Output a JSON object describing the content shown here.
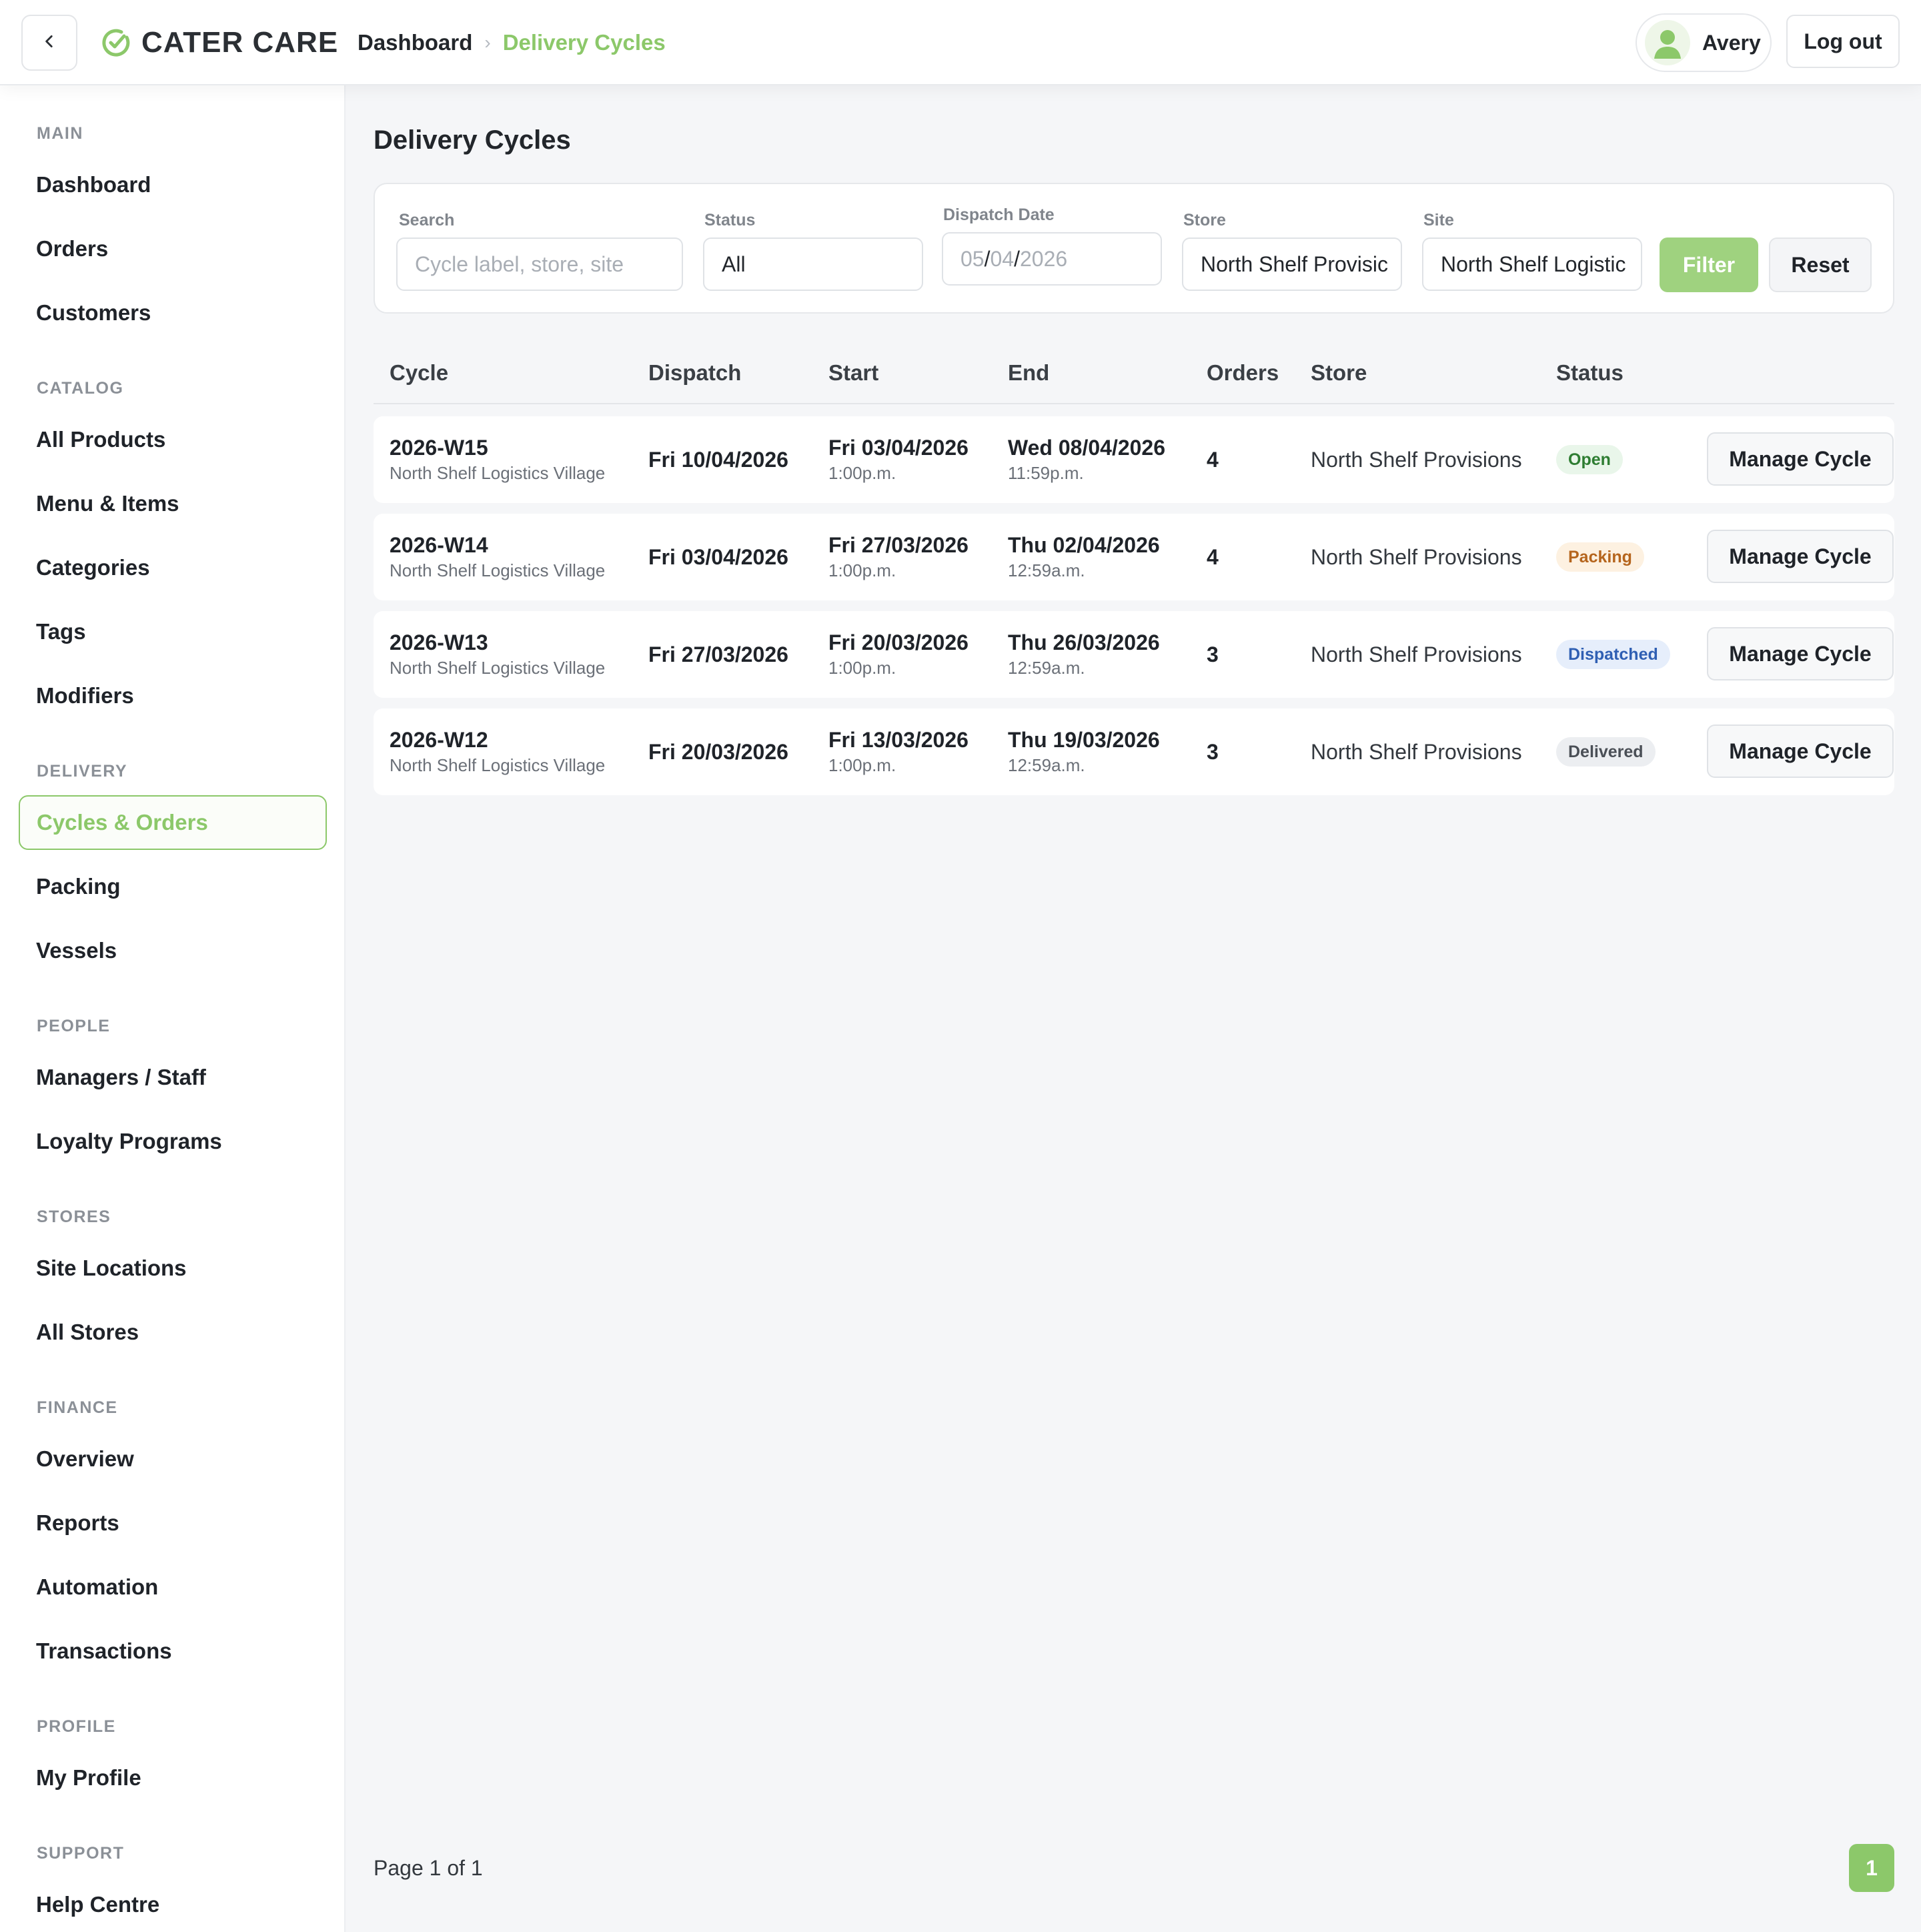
{
  "header": {
    "brand": "CATER CARE",
    "breadcrumb_home": "Dashboard",
    "breadcrumb_separator": "›",
    "breadcrumb_current": "Delivery Cycles",
    "user_name": "Avery",
    "logout_label": "Log out"
  },
  "sidebar": {
    "sections": [
      {
        "title": "MAIN",
        "items": [
          "Dashboard",
          "Orders",
          "Customers"
        ]
      },
      {
        "title": "CATALOG",
        "items": [
          "All Products",
          "Menu & Items",
          "Categories",
          "Tags",
          "Modifiers"
        ]
      },
      {
        "title": "DELIVERY",
        "items": [
          "Cycles & Orders",
          "Packing",
          "Vessels"
        ]
      },
      {
        "title": "PEOPLE",
        "items": [
          "Managers / Staff",
          "Loyalty Programs"
        ]
      },
      {
        "title": "STORES",
        "items": [
          "Site Locations",
          "All Stores"
        ]
      },
      {
        "title": "FINANCE",
        "items": [
          "Overview",
          "Reports",
          "Automation",
          "Transactions"
        ]
      },
      {
        "title": "PROFILE",
        "items": [
          "My Profile"
        ]
      },
      {
        "title": "SUPPORT",
        "items": [
          "Help Centre"
        ]
      }
    ],
    "active_item": "Cycles & Orders"
  },
  "page": {
    "title": "Delivery Cycles"
  },
  "filters": {
    "search_label": "Search",
    "search_placeholder": "Cycle label, store, site",
    "status_label": "Status",
    "status_value": "All",
    "dispatch_label": "Dispatch Date",
    "dispatch_day": "05",
    "dispatch_month": "04",
    "dispatch_year": "2026",
    "date_separator": "/",
    "store_label": "Store",
    "store_value": "North Shelf Provisic",
    "site_label": "Site",
    "site_value": "North Shelf Logistic",
    "filter_button": "Filter",
    "reset_button": "Reset"
  },
  "table": {
    "columns": [
      "Cycle",
      "Dispatch",
      "Start",
      "End",
      "Orders",
      "Store",
      "Status"
    ],
    "action_label": "Manage Cycle",
    "rows": [
      {
        "cycle": "2026-W15",
        "site": "North Shelf Logistics Village",
        "dispatch": "Fri 10/04/2026",
        "start_date": "Fri 03/04/2026",
        "start_time": "1:00p.m.",
        "end_date": "Wed 08/04/2026",
        "end_time": "11:59p.m.",
        "orders": "4",
        "store": "North Shelf Provisions",
        "status": "Open",
        "status_kind": "open"
      },
      {
        "cycle": "2026-W14",
        "site": "North Shelf Logistics Village",
        "dispatch": "Fri 03/04/2026",
        "start_date": "Fri 27/03/2026",
        "start_time": "1:00p.m.",
        "end_date": "Thu 02/04/2026",
        "end_time": "12:59a.m.",
        "orders": "4",
        "store": "North Shelf Provisions",
        "status": "Packing",
        "status_kind": "packing"
      },
      {
        "cycle": "2026-W13",
        "site": "North Shelf Logistics Village",
        "dispatch": "Fri 27/03/2026",
        "start_date": "Fri 20/03/2026",
        "start_time": "1:00p.m.",
        "end_date": "Thu 26/03/2026",
        "end_time": "12:59a.m.",
        "orders": "3",
        "store": "North Shelf Provisions",
        "status": "Dispatched",
        "status_kind": "dispatched"
      },
      {
        "cycle": "2026-W12",
        "site": "North Shelf Logistics Village",
        "dispatch": "Fri 20/03/2026",
        "start_date": "Fri 13/03/2026",
        "start_time": "1:00p.m.",
        "end_date": "Thu 19/03/2026",
        "end_time": "12:59a.m.",
        "orders": "3",
        "store": "North Shelf Provisions",
        "status": "Delivered",
        "status_kind": "delivered"
      }
    ]
  },
  "pagination": {
    "summary": "Page 1 of 1",
    "current_page": "1"
  },
  "colors": {
    "accent": "#8cc86a",
    "filter_button": "#9fd27f",
    "background": "#f5f6f8"
  },
  "icons": {
    "back": "chevron-left-icon",
    "logo": "check-circle-icon",
    "avatar": "user-icon"
  }
}
